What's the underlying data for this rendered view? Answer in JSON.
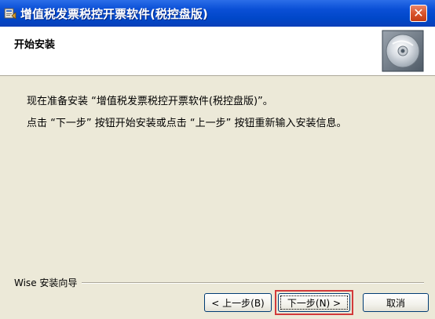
{
  "window": {
    "title": "增值税发票税控开票软件(税控盘版)",
    "close_label": "✕",
    "app_icon": "installer-icon"
  },
  "header": {
    "heading": "开始安装",
    "icon": "cd-disc-icon"
  },
  "body": {
    "line1": "现在准备安装 “增值税发票税控开票软件(税控盘版)”。",
    "line2": "点击 “下一步” 按钮开始安装或点击 “上一步” 按钮重新输入安装信息。"
  },
  "footer": {
    "group_label": "Wise 安装向导",
    "back_label": "< 上一步(B)",
    "next_label": "下一步(N) >",
    "cancel_label": "取消"
  },
  "colors": {
    "titlebar": "#0a4fd6",
    "dialog_bg": "#ece9d8",
    "highlight": "#d23a3a"
  }
}
